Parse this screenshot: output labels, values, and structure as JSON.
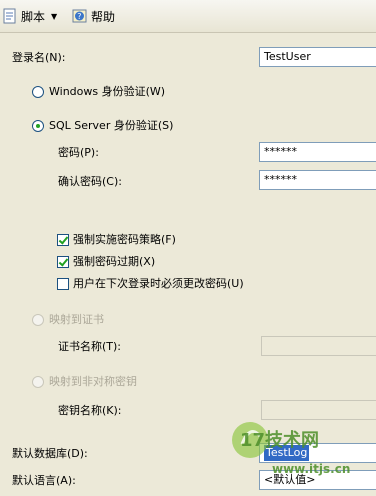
{
  "toolbar": {
    "script_label": "脚本",
    "help_label": "帮助"
  },
  "form": {
    "login_name_label": "登录名(N):",
    "login_name_value": "TestUser",
    "windows_auth_label": "Windows 身份验证(W)",
    "sql_auth_label": "SQL Server 身份验证(S)",
    "password_label": "密码(P):",
    "password_value": "******",
    "confirm_password_label": "确认密码(C):",
    "confirm_password_value": "******",
    "enforce_policy_label": "强制实施密码策略(F)",
    "enforce_policy_checked": true,
    "enforce_expiration_label": "强制密码过期(X)",
    "enforce_expiration_checked": true,
    "must_change_label": "用户在下次登录时必须更改密码(U)",
    "must_change_checked": false,
    "map_cert_label": "映射到证书",
    "cert_name_label": "证书名称(T):",
    "map_asym_label": "映射到非对称密钥",
    "key_name_label": "密钥名称(K):",
    "default_db_label": "默认数据库(D):",
    "default_db_value": "TestLog",
    "default_lang_label": "默认语言(A):",
    "default_lang_value": "<默认值>"
  },
  "watermark": {
    "brand": "17技术网",
    "url": "www.itjs.cn"
  },
  "colors": {
    "background": "#ece9d8",
    "selection": "#316ac5",
    "check_green": "#21a121"
  }
}
